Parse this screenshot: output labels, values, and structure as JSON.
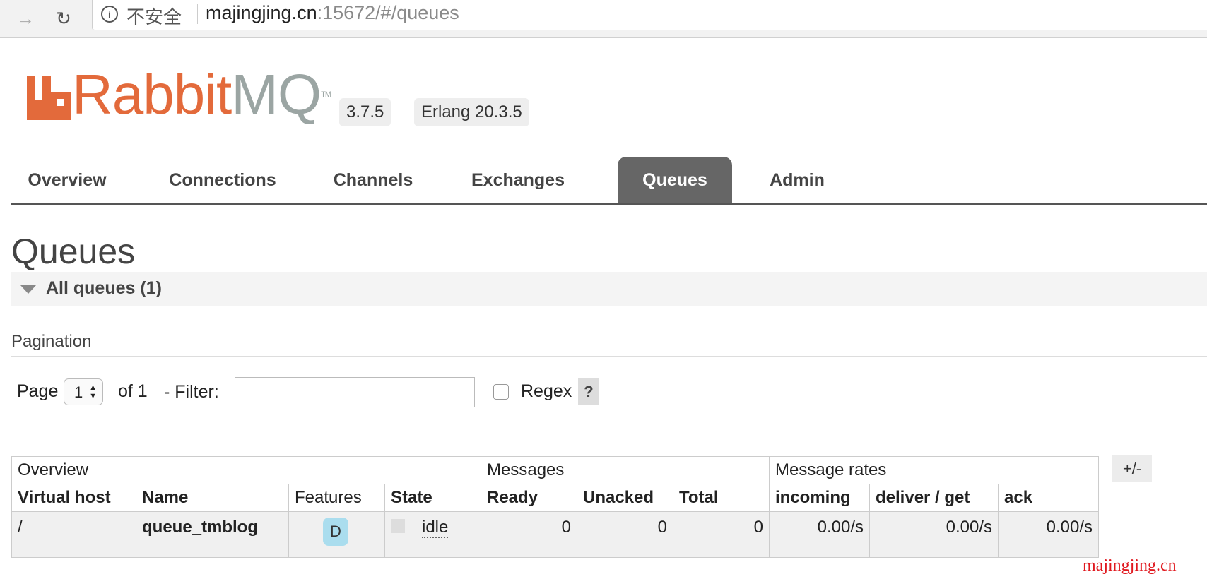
{
  "browser": {
    "insecure_label": "不安全",
    "url_host": "majingjing.cn",
    "url_path": ":15672/#/queues"
  },
  "header": {
    "logo_rabbit": "Rabbit",
    "logo_mq": "MQ",
    "logo_tm": "TM",
    "version": "3.7.5",
    "erlang": "Erlang 20.3.5"
  },
  "tabs": [
    "Overview",
    "Connections",
    "Channels",
    "Exchanges",
    "Queues",
    "Admin"
  ],
  "active_tab": "Queues",
  "page_title": "Queues",
  "section_title": "All queues (1)",
  "pagination": {
    "label": "Pagination",
    "page_label": "Page",
    "page_value": "1",
    "of_label": "of 1",
    "filter_label": "- Filter:",
    "filter_value": "",
    "regex_label": "Regex",
    "help": "?"
  },
  "table": {
    "groups": [
      "Overview",
      "Messages",
      "Message rates"
    ],
    "columns": [
      "Virtual host",
      "Name",
      "Features",
      "State",
      "Ready",
      "Unacked",
      "Total",
      "incoming",
      "deliver / get",
      "ack"
    ],
    "rows": [
      {
        "vhost": "/",
        "name": "queue_tmblog",
        "feature": "D",
        "state": "idle",
        "ready": "0",
        "unacked": "0",
        "total": "0",
        "incoming": "0.00/s",
        "deliver_get": "0.00/s",
        "ack": "0.00/s"
      }
    ],
    "toggle_columns": "+/-"
  },
  "watermark": "majingjing.cn",
  "colors": {
    "brand_orange": "#e36a3b",
    "brand_grey": "#9ba5a3",
    "active_tab": "#666666",
    "feature_badge": "#aaddee"
  },
  "icons": [
    "forward-icon",
    "reload-icon",
    "info-icon",
    "triangle-down-icon",
    "select-arrows-icon"
  ]
}
